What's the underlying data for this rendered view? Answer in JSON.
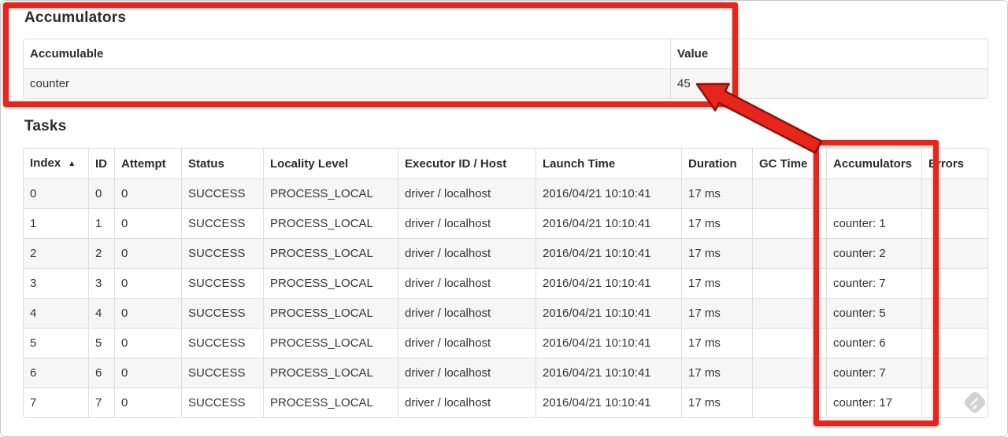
{
  "accumulators_section": {
    "title": "Accumulators",
    "table": {
      "headers": [
        "Accumulable",
        "Value"
      ],
      "rows": [
        [
          "counter",
          "45"
        ]
      ]
    }
  },
  "tasks_section": {
    "title": "Tasks",
    "table": {
      "headers": [
        "Index",
        "ID",
        "Attempt",
        "Status",
        "Locality Level",
        "Executor ID / Host",
        "Launch Time",
        "Duration",
        "GC Time",
        "Accumulators",
        "Errors"
      ],
      "sort": {
        "column_index": 0,
        "icon": "▲"
      },
      "rows": [
        [
          "0",
          "0",
          "0",
          "SUCCESS",
          "PROCESS_LOCAL",
          "driver / localhost",
          "2016/04/21 10:10:41",
          "17 ms",
          "",
          "",
          ""
        ],
        [
          "1",
          "1",
          "0",
          "SUCCESS",
          "PROCESS_LOCAL",
          "driver / localhost",
          "2016/04/21 10:10:41",
          "17 ms",
          "",
          "counter: 1",
          ""
        ],
        [
          "2",
          "2",
          "0",
          "SUCCESS",
          "PROCESS_LOCAL",
          "driver / localhost",
          "2016/04/21 10:10:41",
          "17 ms",
          "",
          "counter: 2",
          ""
        ],
        [
          "3",
          "3",
          "0",
          "SUCCESS",
          "PROCESS_LOCAL",
          "driver / localhost",
          "2016/04/21 10:10:41",
          "17 ms",
          "",
          "counter: 7",
          ""
        ],
        [
          "4",
          "4",
          "0",
          "SUCCESS",
          "PROCESS_LOCAL",
          "driver / localhost",
          "2016/04/21 10:10:41",
          "17 ms",
          "",
          "counter: 5",
          ""
        ],
        [
          "5",
          "5",
          "0",
          "SUCCESS",
          "PROCESS_LOCAL",
          "driver / localhost",
          "2016/04/21 10:10:41",
          "17 ms",
          "",
          "counter: 6",
          ""
        ],
        [
          "6",
          "6",
          "0",
          "SUCCESS",
          "PROCESS_LOCAL",
          "driver / localhost",
          "2016/04/21 10:10:41",
          "17 ms",
          "",
          "counter: 7",
          ""
        ],
        [
          "7",
          "7",
          "0",
          "SUCCESS",
          "PROCESS_LOCAL",
          "driver / localhost",
          "2016/04/21 10:10:41",
          "17 ms",
          "",
          "counter: 17",
          ""
        ]
      ]
    }
  },
  "annotations": {
    "highlight_color": "#e8251a",
    "outline_color": "#8c1208",
    "boxes": [
      "accumulators-section-highlight",
      "accumulators-column-highlight"
    ],
    "arrow_points_to": "45"
  }
}
